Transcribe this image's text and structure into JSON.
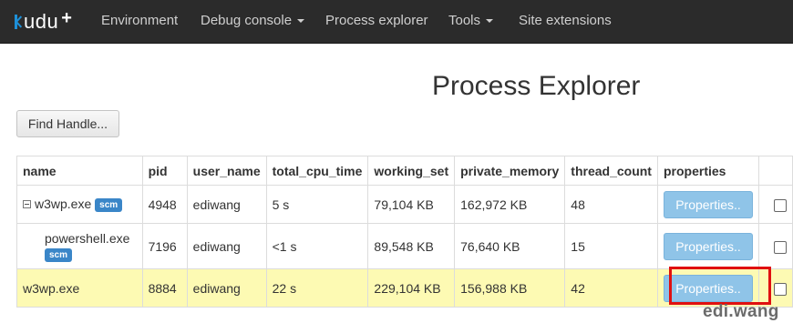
{
  "navbar": {
    "brand_text": "udu",
    "brand_plus": "+",
    "items": [
      {
        "label": "Environment"
      },
      {
        "label": "Debug console",
        "has_dropdown": true
      },
      {
        "label": "Process explorer"
      },
      {
        "label": "Tools",
        "has_dropdown": true
      },
      {
        "label": "Site extensions"
      }
    ]
  },
  "page": {
    "title": "Process Explorer",
    "find_handle_label": "Find Handle..."
  },
  "table": {
    "columns": [
      "name",
      "pid",
      "user_name",
      "total_cpu_time",
      "working_set",
      "private_memory",
      "thread_count",
      "properties"
    ],
    "rows": [
      {
        "name": "w3wp.exe",
        "badge": "scm",
        "pid": "4948",
        "user_name": "ediwang",
        "total_cpu_time": "5 s",
        "working_set": "79,104 KB",
        "private_memory": "162,972 KB",
        "thread_count": "48",
        "properties_label": "Properties.."
      },
      {
        "name": "powershell.exe",
        "badge": "scm",
        "pid": "7196",
        "user_name": "ediwang",
        "total_cpu_time": "<1 s",
        "working_set": "89,548 KB",
        "private_memory": "76,640 KB",
        "thread_count": "15",
        "properties_label": "Properties.."
      },
      {
        "name": "w3wp.exe",
        "pid": "8884",
        "user_name": "ediwang",
        "total_cpu_time": "22 s",
        "working_set": "229,104 KB",
        "private_memory": "156,988 KB",
        "thread_count": "42",
        "properties_label": "Properties.."
      }
    ]
  },
  "colors": {
    "navbar_bg": "#2b2b2b",
    "brand_accent": "#1e90d8",
    "badge_bg": "#3a86c8",
    "properties_button": "#8fc4e8",
    "highlight_row": "#fdfab3",
    "annotation_box": "#e01010"
  },
  "watermark": "edi.wang"
}
